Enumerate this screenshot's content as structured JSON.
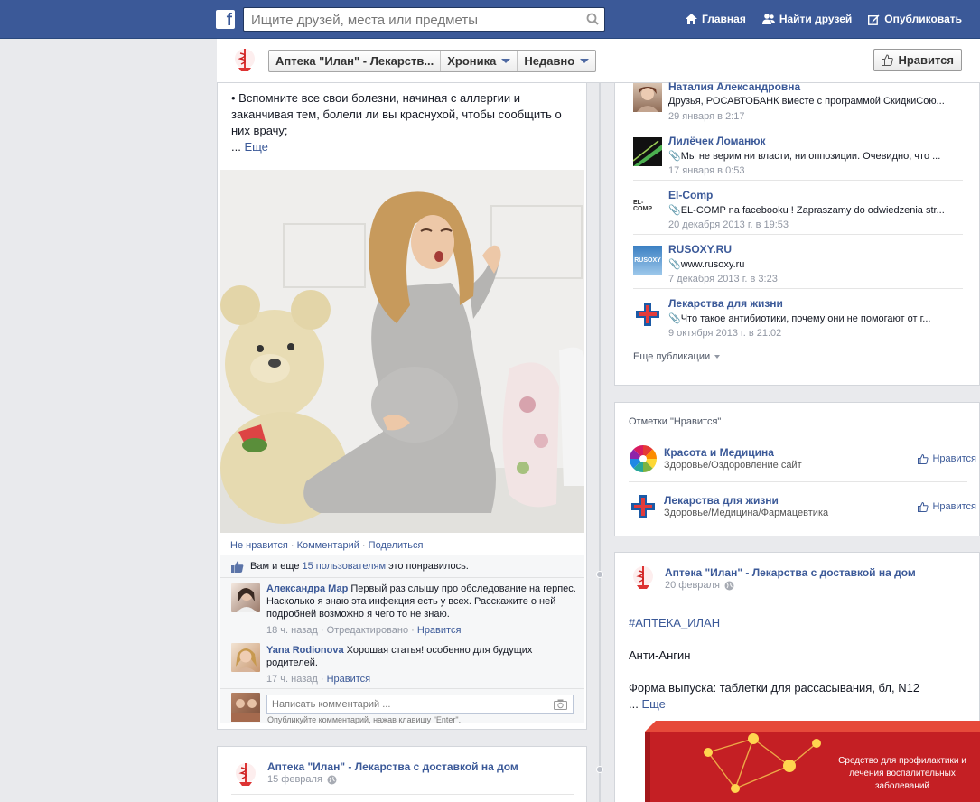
{
  "topbar": {
    "logo": "f",
    "search_placeholder": "Ищите друзей, места или предметы",
    "nav": [
      {
        "label": "Главная",
        "icon": "home-icon"
      },
      {
        "label": "Найти друзей",
        "icon": "friends-icon"
      },
      {
        "label": "Опубликовать",
        "icon": "compose-icon"
      }
    ]
  },
  "pagebar": {
    "crumbs": [
      "Аптека \"Илан\" - Лекарств...",
      "Хроника",
      "Недавно"
    ],
    "like_button": "Нравится"
  },
  "post1": {
    "text": "• Вспомните все свои болезни, начиная с аллергии и заканчивая тем, болели ли вы краснухой, чтобы сообщить о них врачу;",
    "more_prefix": "... ",
    "more": "Еще",
    "actions": [
      "Не нравится",
      "Комментарий",
      "Поделиться"
    ],
    "likes_prefix": "Вам и еще ",
    "likes_link": "15 пользователям",
    "likes_suffix": " это понравилось.",
    "comments": [
      {
        "author": "Александра Мар",
        "text": "Первый раз слышу про обследование на герпес. Насколько я знаю эта инфекция есть у всех. Расскажите о ней подробней возможно я чего то не знаю.",
        "time": "18 ч. назад",
        "edited": "Отредактировано",
        "like": "Нравится"
      },
      {
        "author": "Yana Rodionova",
        "text": "Хорошая статья! особенно для будущих родителей.",
        "time": "17 ч. назад",
        "like": "Нравится"
      }
    ],
    "comment_placeholder": "Написать комментарий ...",
    "comment_hint": "Опубликуйте комментарий, нажав клавишу \"Enter\"."
  },
  "post2": {
    "author": "Аптека \"Илан\" - Лекарства с доставкой на дом",
    "date": "15 февраля"
  },
  "recent": [
    {
      "name": "Наталия Александровна",
      "text": "Друзья, РОСАВТОБАНК вместе с программой СкидкиСою...",
      "time": "29 января в 2:17",
      "clip": false
    },
    {
      "name": "Лилёчек Ломанюк",
      "text": "Мы не верим ни власти, ни оппозиции. Очевидно, что ...",
      "time": "17 января в 0:53",
      "clip": true
    },
    {
      "name": "El-Comp",
      "text": "EL-COMP na facebooku ! Zapraszamy do odwiedzenia str...",
      "time": "20 декабря 2013 г. в 19:53",
      "clip": true,
      "thumb_text": "EL-COMP"
    },
    {
      "name": "RUSOXY.RU",
      "text": "www.rusoxy.ru",
      "time": "7 декабря 2013 г. в 3:23",
      "clip": true,
      "thumb_text": "RUSOXY"
    },
    {
      "name": "Лекарства для жизни",
      "text": "Что такое антибиотики, почему они не помогают от г...",
      "time": "9 октября 2013 г. в 21:02",
      "clip": true
    }
  ],
  "recent_more": "Еще публикации",
  "likes_box": {
    "title": "Отметки \"Нравится\"",
    "items": [
      {
        "name": "Красота и Медицина",
        "category": "Здоровье/Оздоровление сайт",
        "button": "Нравится"
      },
      {
        "name": "Лекарства для жизни",
        "category": "Здоровье/Медицина/Фармацевтика",
        "button": "Нравится"
      }
    ]
  },
  "post3": {
    "author": "Аптека \"Илан\" - Лекарства с доставкой на дом",
    "date": "20 февраля",
    "hashtag": "#АПТЕКА_ИЛАН",
    "line1": "Анти-Ангин",
    "line2": "Форма выпуска: таблетки для рассасывания, бл, N12",
    "more_prefix": "... ",
    "more": "Еще",
    "box_text": "Средство для профилактики и лечения воспалительных заболеваний"
  },
  "colors": {
    "brand": "#3b5998",
    "link": "#3b5998",
    "meta": "#9197a3"
  }
}
